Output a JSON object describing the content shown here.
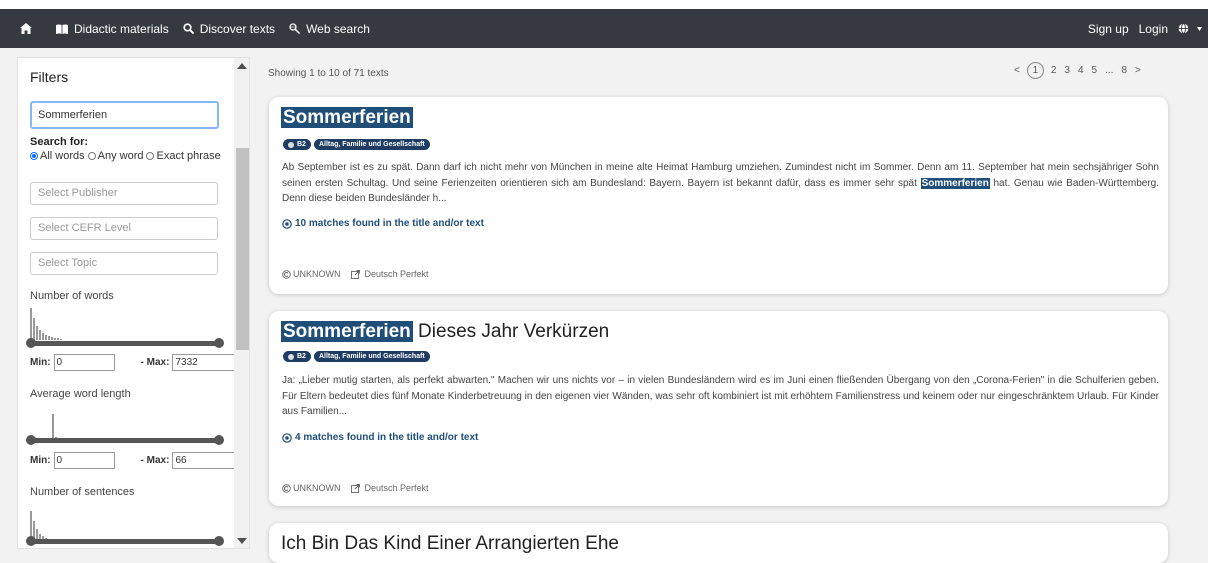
{
  "nav": {
    "didactic": "Didactic materials",
    "discover": "Discover texts",
    "websearch": "Web search",
    "signup": "Sign up",
    "login": "Login"
  },
  "filters": {
    "title": "Filters",
    "search_value": "Sommerferien",
    "search_for_label": "Search for:",
    "radio_all": "All words",
    "radio_any": "Any word",
    "radio_exact": "Exact phrase",
    "publisher_placeholder": "Select Publisher",
    "cefr_placeholder": "Select CEFR Level",
    "topic_placeholder": "Select Topic",
    "num_words_label": "Number of words",
    "num_words_min": "0",
    "num_words_max": "7332",
    "avg_len_label": "Average word length",
    "avg_len_min": "0",
    "avg_len_max": "66",
    "num_sentences_label": "Number of sentences",
    "min_label": "Min:",
    "max_label": "- Max:"
  },
  "results": {
    "showing": "Showing 1 to 10 of 71 texts",
    "pages": [
      "<",
      "1",
      "2",
      "3",
      "4",
      "5",
      "...",
      "8",
      ">"
    ],
    "cards": [
      {
        "title_highlight": "Sommerferien",
        "title_rest": "",
        "level": "B2",
        "topic": "Alltag, Familie und Gesellschaft",
        "excerpt_before": "Ab September ist es zu spät. Dann darf ich nicht mehr von München in meine alte Heimat Hamburg umziehen. Zumindest nicht im Sommer. Denn am 11. September hat mein sechsjähriger Sohn seinen ersten Schultag. Und seine Ferienzeiten orientieren sich am Bundesland: Bayern. Bayern ist bekannt dafür, dass es immer sehr spät ",
        "excerpt_highlight": "Sommerferien",
        "excerpt_after": " hat. Genau wie Baden-Württemberg. Denn diese beiden Bundesländer h...",
        "matches": "10 matches found in the title and/or text",
        "license": "UNKNOWN",
        "source": "Deutsch Perfekt"
      },
      {
        "title_highlight": "Sommerferien",
        "title_rest": " Dieses Jahr Verkürzen",
        "level": "B2",
        "topic": "Alltag, Familie und Gesellschaft",
        "excerpt_before": "Ja: „Lieber mutig starten, als perfekt abwarten.\" Machen wir uns nichts vor – in vielen Bundesländern wird es im Juni einen fließenden Übergang von den „Corona-Ferien\" in die Schulferien geben. Für Eltern bedeutet dies fünf Monate Kinderbetreuung in den eigenen vier Wänden, was sehr oft kombiniert ist mit erhöhtem Familienstress und keinem oder nur eingeschränktem Urlaub. Für Kinder aus Familien...",
        "excerpt_highlight": "",
        "excerpt_after": "",
        "matches": "4 matches found in the title and/or text",
        "license": "UNKNOWN",
        "source": "Deutsch Perfekt"
      },
      {
        "title_highlight": "",
        "title_rest": "Ich Bin Das Kind Einer Arrangierten Ehe"
      }
    ]
  },
  "colors": {
    "navbar": "#343a40",
    "highlight": "#1f4e79",
    "badge": "#1f3c63"
  }
}
